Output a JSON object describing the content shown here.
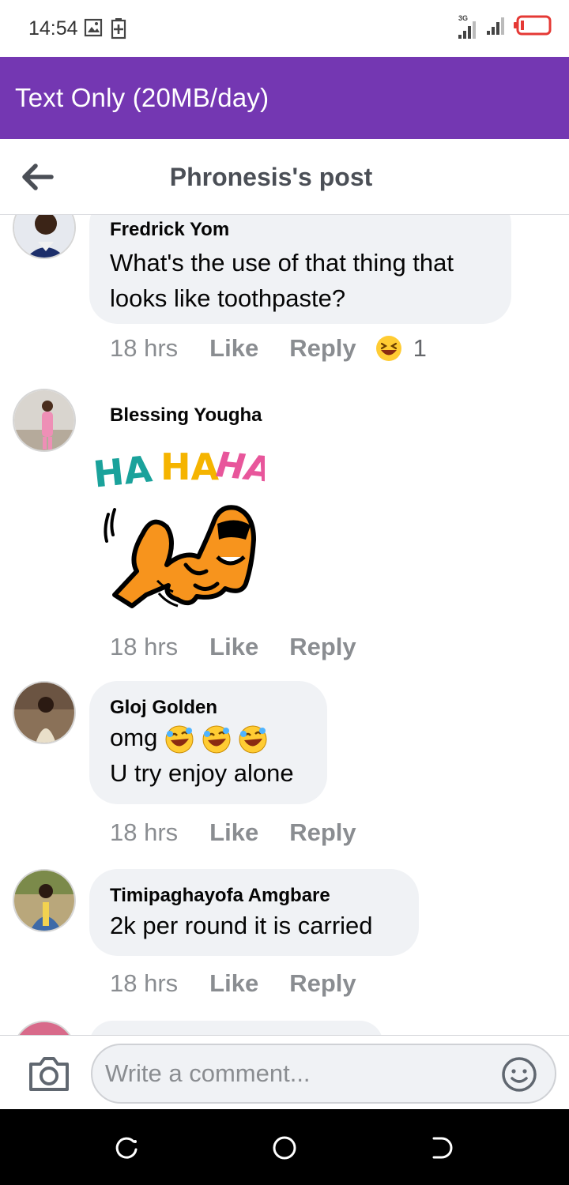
{
  "status_bar": {
    "time": "14:54",
    "network_label": "3G",
    "icons": [
      "image-notification-icon",
      "battery-saver-icon",
      "signal-icon",
      "signal-icon",
      "battery-icon"
    ]
  },
  "banner": {
    "text": "Text Only (20MB/day)",
    "color": "#7437b2"
  },
  "header": {
    "title": "Phronesis's post",
    "back_icon": "back-arrow-icon"
  },
  "comments": [
    {
      "name": "Fredrick Yom",
      "text_lines": [
        "What's the use of that thing that",
        "looks like toothpaste?"
      ],
      "time": "18 hrs",
      "like": "Like",
      "reply": "Reply",
      "reaction": {
        "icon": "laughing-emoji-icon",
        "count": "1"
      }
    },
    {
      "name": "Blessing Yougha",
      "sticker": {
        "text": "HA HA HA",
        "icon": "laughing-dog-sticker"
      },
      "time": "18 hrs",
      "like": "Like",
      "reply": "Reply"
    },
    {
      "name": "Gloj Golden",
      "text_lines": [
        "omg",
        "U try enjoy alone"
      ],
      "emojis": [
        "rofl-emoji-icon",
        "rofl-emoji-icon",
        "rofl-emoji-icon"
      ],
      "time": "18 hrs",
      "like": "Like",
      "reply": "Reply"
    },
    {
      "name": "Timipaghayofa Amgbare",
      "text_lines": [
        "2k per round it is carried"
      ],
      "time": "18 hrs",
      "like": "Like",
      "reply": "Reply"
    }
  ],
  "composer": {
    "placeholder": "Write a comment...",
    "camera_icon": "camera-icon",
    "emoji_icon": "smiley-icon"
  },
  "nav_bar": {
    "icons": [
      "recent-apps-icon",
      "home-icon",
      "back-icon"
    ]
  }
}
